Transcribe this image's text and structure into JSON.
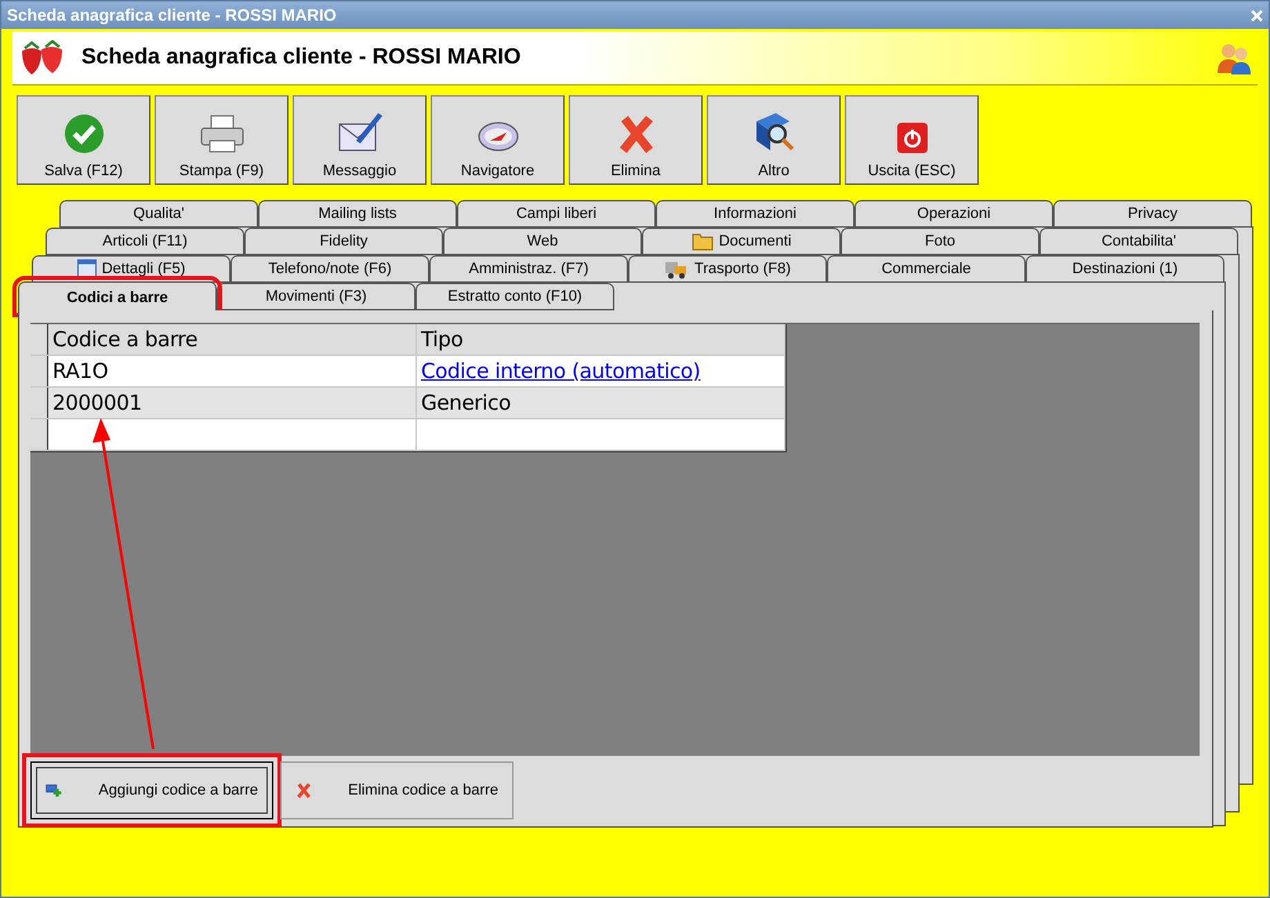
{
  "window": {
    "title": "Scheda anagrafica cliente - ROSSI MARIO"
  },
  "header": {
    "title": "Scheda anagrafica cliente - ROSSI MARIO"
  },
  "toolbar": [
    {
      "label": "Salva (F12)",
      "kind": "check"
    },
    {
      "label": "Stampa (F9)",
      "kind": "printer"
    },
    {
      "label": "Messaggio",
      "kind": "mail"
    },
    {
      "label": "Navigatore",
      "kind": "compass"
    },
    {
      "label": "Elimina",
      "kind": "cross"
    },
    {
      "label": "Altro",
      "kind": "book"
    },
    {
      "label": "Uscita (ESC)",
      "kind": "power"
    }
  ],
  "tab_rows": [
    [
      {
        "label": "Qualita'",
        "kind": "plain",
        "selected": false
      },
      {
        "label": "Mailing lists",
        "kind": "plain",
        "selected": false
      },
      {
        "label": "Campi liberi",
        "kind": "plain",
        "selected": false
      },
      {
        "label": "Informazioni",
        "kind": "plain",
        "selected": false
      },
      {
        "label": "Operazioni",
        "kind": "plain",
        "selected": false
      },
      {
        "label": "Privacy",
        "kind": "plain",
        "selected": false
      }
    ],
    [
      {
        "label": "Articoli (F11)",
        "kind": "plain",
        "selected": false
      },
      {
        "label": "Fidelity",
        "kind": "plain",
        "selected": false
      },
      {
        "label": "Web",
        "kind": "plain",
        "selected": false
      },
      {
        "label": "Documenti",
        "kind": "folder",
        "selected": false
      },
      {
        "label": "Foto",
        "kind": "plain",
        "selected": false
      },
      {
        "label": "Contabilita'",
        "kind": "plain",
        "selected": false
      }
    ],
    [
      {
        "label": "Dettagli (F5)",
        "kind": "calendar",
        "selected": false
      },
      {
        "label": "Telefono/note (F6)",
        "kind": "plain",
        "selected": false
      },
      {
        "label": "Amministraz. (F7)",
        "kind": "plain",
        "selected": false
      },
      {
        "label": "Trasporto (F8)",
        "kind": "truck",
        "selected": false
      },
      {
        "label": "Commerciale",
        "kind": "plain",
        "selected": false
      },
      {
        "label": "Destinazioni (1)",
        "kind": "plain",
        "selected": false
      }
    ],
    [
      {
        "label": "Codici a barre",
        "kind": "plain",
        "selected": true,
        "highlighted": true
      },
      {
        "label": "Movimenti (F3)",
        "kind": "plain",
        "selected": false,
        "highlighted": false
      },
      {
        "label": "Estratto conto (F10)",
        "kind": "plain",
        "selected": false,
        "highlighted": false
      }
    ]
  ],
  "table": {
    "columns": [
      "Codice a barre",
      "Tipo"
    ],
    "rows": [
      {
        "cells": [
          "RA1O",
          "Codice interno (automatico)"
        ],
        "link": true
      },
      {
        "cells": [
          "2000001",
          "Generico"
        ],
        "link": false
      }
    ]
  },
  "buttons": [
    {
      "label": "Aggiungi codice a barre",
      "kind": "add",
      "focused": true,
      "highlighted": true
    },
    {
      "label": "Elimina codice a barre",
      "kind": "delete",
      "focused": false,
      "highlighted": false
    }
  ]
}
